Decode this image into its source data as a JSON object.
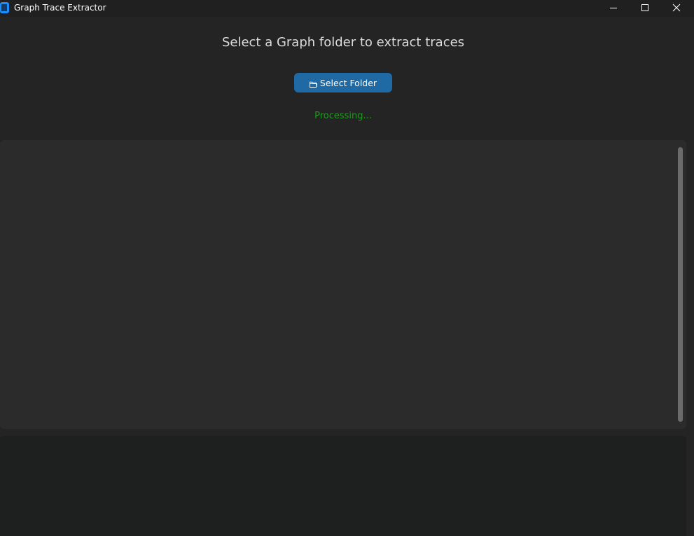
{
  "window": {
    "title": "Graph Trace Extractor",
    "icons": {
      "app": "app-icon",
      "minimize": "minimize-icon",
      "maximize": "maximize-icon",
      "close": "close-icon"
    }
  },
  "main": {
    "heading": "Select a Graph folder to extract traces",
    "select_button": {
      "label": "Select Folder",
      "icon": "folder-icon"
    },
    "status": "Processing..."
  },
  "colors": {
    "background": "#242424",
    "titlebar": "#202020",
    "accent": "#1f6aa5",
    "status": "#1f9a1f",
    "panel": "#2b2b2b",
    "panel_bottom": "#1e1f1f"
  }
}
